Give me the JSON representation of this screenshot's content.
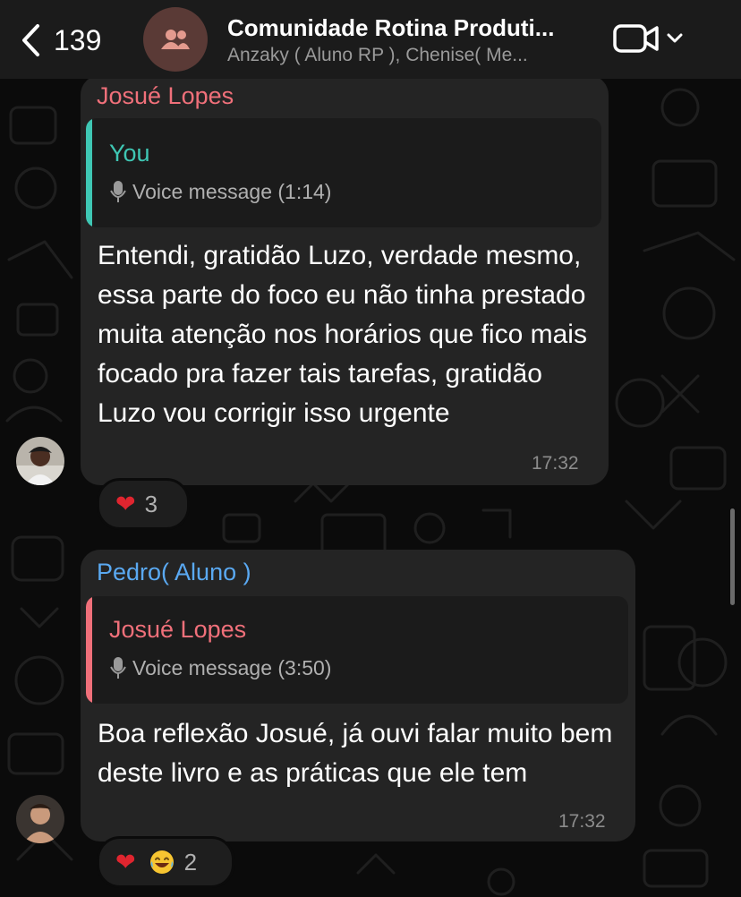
{
  "header": {
    "back_count": "139",
    "title": "Comunidade Rotina Produti...",
    "subtitle": "Anzaky ( Aluno RP ), Chenise( Me..."
  },
  "messages": [
    {
      "sender": "Josué Lopes",
      "sender_color": "#f0707a",
      "quote": {
        "name": "You",
        "name_color": "#3fc7b4",
        "voice": "Voice message (1:14)"
      },
      "text": "Entendi, gratidão Luzo, verdade mesmo, essa parte do foco eu não tinha prestado muita atenção nos horários que fico mais focado pra fazer tais tarefas, gratidão Luzo vou corrigir isso urgente",
      "time": "17:32",
      "reactions": {
        "emojis": [
          "❤️"
        ],
        "count": "3"
      }
    },
    {
      "sender": "Pedro( Aluno )",
      "sender_color": "#5aa9f2",
      "quote": {
        "name": "Josué Lopes",
        "name_color": "#f0707a",
        "voice": "Voice message (3:50)"
      },
      "text": "Boa reflexão Josué, já ouvi falar muito bem deste livro e as práticas que ele tem",
      "time": "17:32",
      "reactions": {
        "emojis": [
          "❤️",
          "😂"
        ],
        "count": "2"
      }
    }
  ],
  "icons": {
    "back": "chevron-left-icon",
    "group": "group-icon",
    "video": "video-camera-icon",
    "mic": "mic-icon"
  }
}
